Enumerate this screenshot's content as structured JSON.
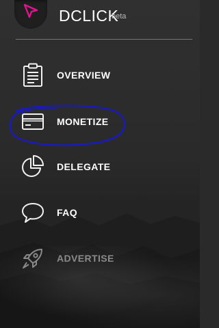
{
  "app": {
    "brand": "DCLICK",
    "badge": "beta"
  },
  "menu": {
    "items": [
      {
        "label": "OVERVIEW",
        "icon": "clipboard-icon",
        "enabled": true
      },
      {
        "label": "MONETIZE",
        "icon": "credit-card-icon",
        "enabled": true
      },
      {
        "label": "DELEGATE",
        "icon": "pie-chart-icon",
        "enabled": true
      },
      {
        "label": "FAQ",
        "icon": "speech-bubble-icon",
        "enabled": true
      },
      {
        "label": "ADVERTISE",
        "icon": "rocket-icon",
        "enabled": false
      }
    ]
  },
  "colors": {
    "accent": "#e0158f",
    "annotation": "#1b1bb5",
    "text": "#ffffff",
    "disabled_text": "#8a8a8a"
  }
}
